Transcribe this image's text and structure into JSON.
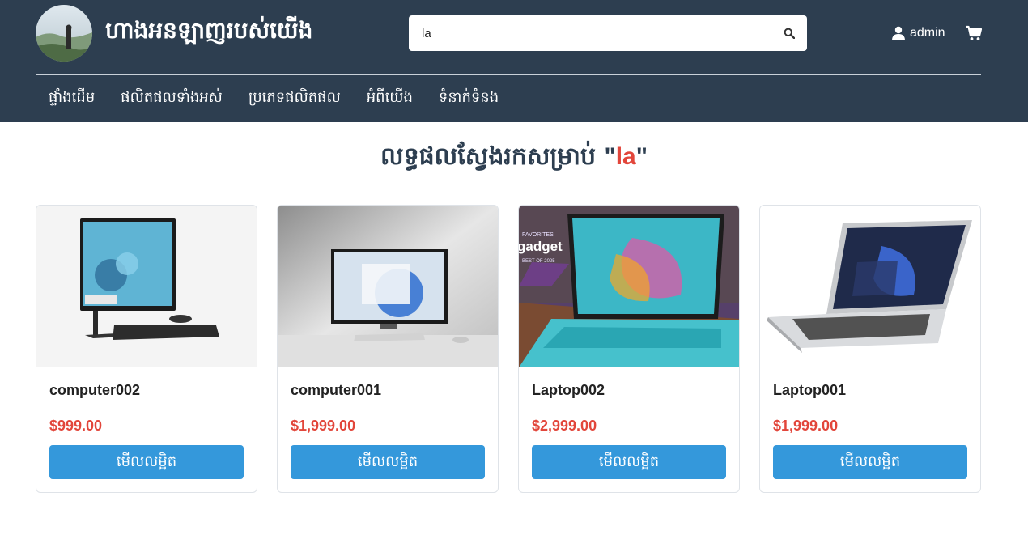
{
  "header": {
    "store_name": "ហាងអនឡាញរបស់យើង",
    "avatar_icon": "profile-photo",
    "search": {
      "value": "la",
      "icon": "search-icon"
    },
    "user": {
      "name": "admin",
      "icon": "user-icon"
    },
    "cart_icon": "cart-icon",
    "bg_color": "#2d3e50"
  },
  "nav": [
    {
      "label": "ផ្ទាំងដើម"
    },
    {
      "label": "ផលិតផលទាំងអស់"
    },
    {
      "label": "ប្រភេទផលិតផល"
    },
    {
      "label": "អំពីយើង"
    },
    {
      "label": "ទំនាក់ទំនង"
    }
  ],
  "results": {
    "prefix": "លទ្ធផលស្វែងរកសម្រាប់ ",
    "open_quote": "\"",
    "query": "la",
    "close_quote": "\""
  },
  "products": [
    {
      "name": "computer002",
      "price": "$999.00",
      "button": "មើលលម្អិត",
      "image": "all-in-one-desktop"
    },
    {
      "name": "computer001",
      "price": "$1,999.00",
      "button": "មើលលម្អិត",
      "image": "desktop-monitor"
    },
    {
      "name": "Laptop002",
      "price": "$2,999.00",
      "button": "មើលលម្អិត",
      "image": "laptop-on-table",
      "badge": {
        "line1": "FAVORITES",
        "line2": "gadget",
        "line3": "BEST OF 2025"
      }
    },
    {
      "name": "Laptop001",
      "price": "$1,999.00",
      "button": "មើលលម្អិត",
      "image": "silver-laptop"
    }
  ],
  "colors": {
    "accent": "#3498db",
    "price": "#e2463b",
    "title": "#2d3e50"
  }
}
